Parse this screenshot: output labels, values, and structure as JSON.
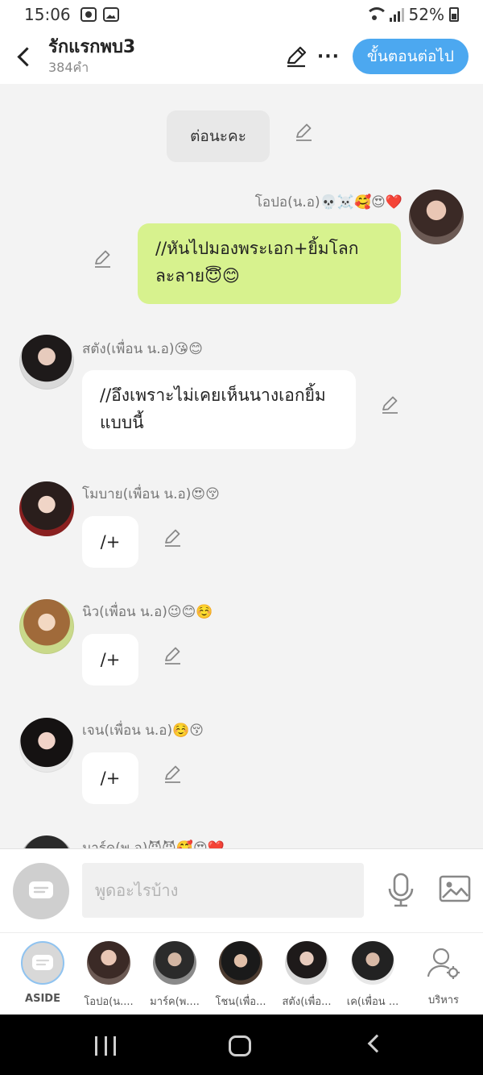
{
  "status_bar": {
    "time": "15:06",
    "battery": "52%"
  },
  "header": {
    "title": "รักแรกพบ3",
    "word_count": "384คำ",
    "next_button": "ขั้นตอนต่อไป"
  },
  "chat": {
    "narration": "ต่อนะคะ",
    "messages": [
      {
        "sender": "โอปอ(น.อ)💀☠️🥰😍❤️",
        "text": "//หันไปมองพระเอก+ยิ้มโลกละลาย😇😊"
      },
      {
        "sender": "สตัง(เพื่อน น.อ)😘😊",
        "text": "//อึงเพราะไม่เคยเห็นนางเอกยิ้มแบบนี้"
      },
      {
        "sender": "โมบาย(เพื่อน น.อ)😍😚",
        "text": "/+"
      },
      {
        "sender": "นิว(เพื่อน น.อ)😉😊☺️",
        "text": "/+"
      },
      {
        "sender": "เจน(เพื่อน น.อ)☺️😚",
        "text": "/+"
      },
      {
        "sender": "มาร์ค(พ.อ)😈😈🥰😍❤️"
      }
    ]
  },
  "input": {
    "placeholder": "พูดอะไรบ้าง"
  },
  "characters": [
    {
      "label": "ASIDE"
    },
    {
      "label": "โอปอ(น...."
    },
    {
      "label": "มาร์ค(พ...."
    },
    {
      "label": "โชน(เพื่อ..."
    },
    {
      "label": "สตัง(เพื่อ..."
    },
    {
      "label": "เค(เพื่อน ..."
    },
    {
      "label": "บริหาร"
    }
  ],
  "colors": {
    "accent": "#4ca8f0",
    "bubble_self": "#d7f28e",
    "bubble_other": "#ffffff"
  },
  "icons": [
    "back-icon",
    "edit-icon",
    "more-icon",
    "mic-icon",
    "image-icon",
    "manage-icon"
  ]
}
